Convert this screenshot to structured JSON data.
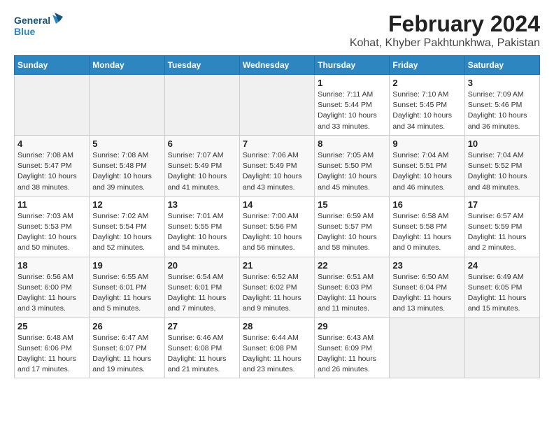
{
  "header": {
    "logo_line1": "General",
    "logo_line2": "Blue",
    "title": "February 2024",
    "subtitle": "Kohat, Khyber Pakhtunkhwa, Pakistan"
  },
  "weekdays": [
    "Sunday",
    "Monday",
    "Tuesday",
    "Wednesday",
    "Thursday",
    "Friday",
    "Saturday"
  ],
  "weeks": [
    [
      {
        "day": "",
        "detail": ""
      },
      {
        "day": "",
        "detail": ""
      },
      {
        "day": "",
        "detail": ""
      },
      {
        "day": "",
        "detail": ""
      },
      {
        "day": "1",
        "detail": "Sunrise: 7:11 AM\nSunset: 5:44 PM\nDaylight: 10 hours\nand 33 minutes."
      },
      {
        "day": "2",
        "detail": "Sunrise: 7:10 AM\nSunset: 5:45 PM\nDaylight: 10 hours\nand 34 minutes."
      },
      {
        "day": "3",
        "detail": "Sunrise: 7:09 AM\nSunset: 5:46 PM\nDaylight: 10 hours\nand 36 minutes."
      }
    ],
    [
      {
        "day": "4",
        "detail": "Sunrise: 7:08 AM\nSunset: 5:47 PM\nDaylight: 10 hours\nand 38 minutes."
      },
      {
        "day": "5",
        "detail": "Sunrise: 7:08 AM\nSunset: 5:48 PM\nDaylight: 10 hours\nand 39 minutes."
      },
      {
        "day": "6",
        "detail": "Sunrise: 7:07 AM\nSunset: 5:49 PM\nDaylight: 10 hours\nand 41 minutes."
      },
      {
        "day": "7",
        "detail": "Sunrise: 7:06 AM\nSunset: 5:49 PM\nDaylight: 10 hours\nand 43 minutes."
      },
      {
        "day": "8",
        "detail": "Sunrise: 7:05 AM\nSunset: 5:50 PM\nDaylight: 10 hours\nand 45 minutes."
      },
      {
        "day": "9",
        "detail": "Sunrise: 7:04 AM\nSunset: 5:51 PM\nDaylight: 10 hours\nand 46 minutes."
      },
      {
        "day": "10",
        "detail": "Sunrise: 7:04 AM\nSunset: 5:52 PM\nDaylight: 10 hours\nand 48 minutes."
      }
    ],
    [
      {
        "day": "11",
        "detail": "Sunrise: 7:03 AM\nSunset: 5:53 PM\nDaylight: 10 hours\nand 50 minutes."
      },
      {
        "day": "12",
        "detail": "Sunrise: 7:02 AM\nSunset: 5:54 PM\nDaylight: 10 hours\nand 52 minutes."
      },
      {
        "day": "13",
        "detail": "Sunrise: 7:01 AM\nSunset: 5:55 PM\nDaylight: 10 hours\nand 54 minutes."
      },
      {
        "day": "14",
        "detail": "Sunrise: 7:00 AM\nSunset: 5:56 PM\nDaylight: 10 hours\nand 56 minutes."
      },
      {
        "day": "15",
        "detail": "Sunrise: 6:59 AM\nSunset: 5:57 PM\nDaylight: 10 hours\nand 58 minutes."
      },
      {
        "day": "16",
        "detail": "Sunrise: 6:58 AM\nSunset: 5:58 PM\nDaylight: 11 hours\nand 0 minutes."
      },
      {
        "day": "17",
        "detail": "Sunrise: 6:57 AM\nSunset: 5:59 PM\nDaylight: 11 hours\nand 2 minutes."
      }
    ],
    [
      {
        "day": "18",
        "detail": "Sunrise: 6:56 AM\nSunset: 6:00 PM\nDaylight: 11 hours\nand 3 minutes."
      },
      {
        "day": "19",
        "detail": "Sunrise: 6:55 AM\nSunset: 6:01 PM\nDaylight: 11 hours\nand 5 minutes."
      },
      {
        "day": "20",
        "detail": "Sunrise: 6:54 AM\nSunset: 6:01 PM\nDaylight: 11 hours\nand 7 minutes."
      },
      {
        "day": "21",
        "detail": "Sunrise: 6:52 AM\nSunset: 6:02 PM\nDaylight: 11 hours\nand 9 minutes."
      },
      {
        "day": "22",
        "detail": "Sunrise: 6:51 AM\nSunset: 6:03 PM\nDaylight: 11 hours\nand 11 minutes."
      },
      {
        "day": "23",
        "detail": "Sunrise: 6:50 AM\nSunset: 6:04 PM\nDaylight: 11 hours\nand 13 minutes."
      },
      {
        "day": "24",
        "detail": "Sunrise: 6:49 AM\nSunset: 6:05 PM\nDaylight: 11 hours\nand 15 minutes."
      }
    ],
    [
      {
        "day": "25",
        "detail": "Sunrise: 6:48 AM\nSunset: 6:06 PM\nDaylight: 11 hours\nand 17 minutes."
      },
      {
        "day": "26",
        "detail": "Sunrise: 6:47 AM\nSunset: 6:07 PM\nDaylight: 11 hours\nand 19 minutes."
      },
      {
        "day": "27",
        "detail": "Sunrise: 6:46 AM\nSunset: 6:08 PM\nDaylight: 11 hours\nand 21 minutes."
      },
      {
        "day": "28",
        "detail": "Sunrise: 6:44 AM\nSunset: 6:08 PM\nDaylight: 11 hours\nand 23 minutes."
      },
      {
        "day": "29",
        "detail": "Sunrise: 6:43 AM\nSunset: 6:09 PM\nDaylight: 11 hours\nand 26 minutes."
      },
      {
        "day": "",
        "detail": ""
      },
      {
        "day": "",
        "detail": ""
      }
    ]
  ]
}
